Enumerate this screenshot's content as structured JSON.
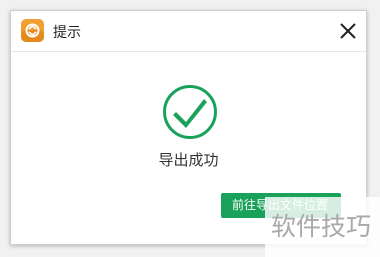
{
  "dialog": {
    "title": "提示",
    "app_icon": "app-logo-icon",
    "close_icon": "close-icon",
    "success_icon": "check-circle-icon",
    "message": "导出成功",
    "open_location_label": "前往导出文件位置"
  },
  "watermark": {
    "text": "软件技巧"
  },
  "colors": {
    "accent_green": "#1aa15a",
    "app_icon_orange": "#f0a030"
  }
}
